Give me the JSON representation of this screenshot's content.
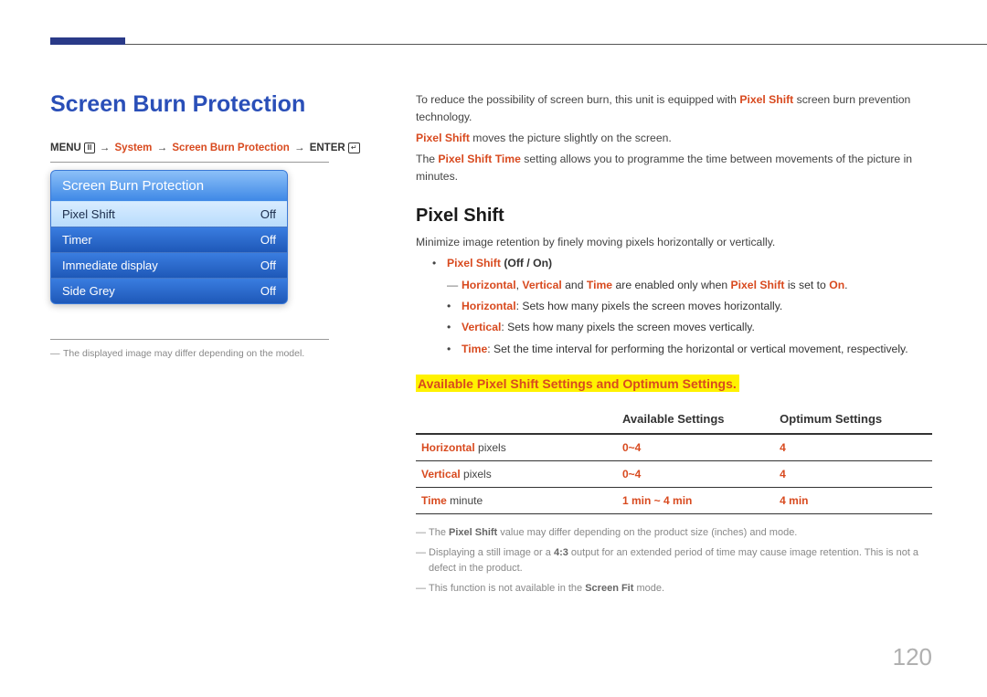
{
  "page_number": "120",
  "left": {
    "title": "Screen Burn Protection",
    "nav": {
      "menu": "MENU",
      "system": "System",
      "path_item": "Screen Burn Protection",
      "enter": "ENTER",
      "arrow": "→"
    },
    "panel": {
      "header": "Screen Burn Protection",
      "rows": [
        {
          "label": "Pixel Shift",
          "value": "Off",
          "highlight": true
        },
        {
          "label": "Timer",
          "value": "Off",
          "highlight": false
        },
        {
          "label": "Immediate display",
          "value": "Off",
          "highlight": false
        },
        {
          "label": "Side Grey",
          "value": "Off",
          "highlight": false
        }
      ]
    },
    "footnote": "The displayed image may differ depending on the model."
  },
  "right": {
    "intro1_pre": "To reduce the possibility of screen burn, this unit is equipped with ",
    "intro1_term": "Pixel Shift",
    "intro1_post": " screen burn prevention technology.",
    "intro2_term": "Pixel Shift",
    "intro2_post": " moves the picture slightly on the screen.",
    "intro3_pre": "The ",
    "intro3_term": "Pixel Shift Time",
    "intro3_post": " setting allows you to programme the time between movements of the picture in minutes.",
    "h2": "Pixel Shift",
    "desc": "Minimize image retention by finely moving pixels horizontally or vertically.",
    "bullet1_term": "Pixel Shift",
    "bullet1_options": "(Off / On)",
    "dash_h": "Horizontal",
    "dash_v": "Vertical",
    "dash_and": " and ",
    "dash_t": "Time",
    "dash_mid": " are enabled only when ",
    "dash_ps": "Pixel Shift",
    "dash_set": " is set to ",
    "dash_on": "On",
    "sub_h_label": "Horizontal",
    "sub_h_text": ": Sets how many pixels the screen moves horizontally.",
    "sub_v_label": "Vertical",
    "sub_v_text": ": Sets how many pixels the screen moves vertically.",
    "sub_t_label": "Time",
    "sub_t_text": ": Set the time interval for performing the horizontal or vertical movement, respectively.",
    "subheading": "Available Pixel Shift Settings and Optimum Settings.",
    "table": {
      "col1": "",
      "col2": "Available Settings",
      "col3": "Optimum Settings",
      "rows": [
        {
          "label": "Horizontal",
          "unit": "pixels",
          "avail": "0~4",
          "opt": "4"
        },
        {
          "label": "Vertical",
          "unit": "pixels",
          "avail": "0~4",
          "opt": "4"
        },
        {
          "label": "Time",
          "unit": "minute",
          "avail": "1 min ~ 4 min",
          "opt": "4 min"
        }
      ]
    },
    "note1_pre": "The ",
    "note1_term": "Pixel Shift",
    "note1_post": " value may differ depending on the product size (inches) and mode.",
    "note2_pre": "Displaying a still image or a ",
    "note2_term": "4:3",
    "note2_post": " output for an extended period of time may cause image retention. This is not a defect in the product.",
    "note3_pre": "This function is not available in the ",
    "note3_term": "Screen Fit",
    "note3_post": " mode."
  }
}
